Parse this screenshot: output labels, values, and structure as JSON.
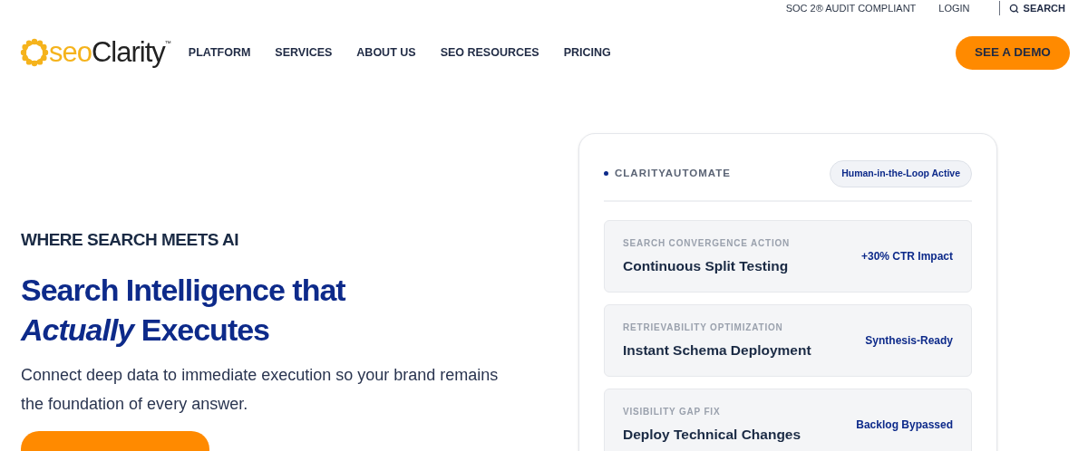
{
  "top_bar": {
    "links": [
      "SOC 2® AUDIT COMPLIANT",
      "LOGIN"
    ],
    "search": "SEARCH"
  },
  "header": {
    "logo": {
      "prefix": "seo",
      "name": "Clarity",
      "mark": "™"
    },
    "nav": [
      "PLATFORM",
      "SERVICES",
      "ABOUT US",
      "SEO RESOURCES",
      "PRICING"
    ],
    "cta": "SEE A DEMO"
  },
  "hero": {
    "eyebrow": "WHERE SEARCH MEETS AI",
    "title": "Search Intelligence that *Actually* Executes",
    "subtitle": "Connect deep data to immediate execution so your brand remains the foundation of every answer."
  },
  "panel": {
    "title": "CLARITYAUTOMATE",
    "status": "Human-in-the-Loop Active",
    "items": [
      {
        "category": "SEARCH CONVERGENCE ACTION",
        "title": "Continuous Split Testing",
        "result": "+30% CTR Impact"
      },
      {
        "category": "RETRIEVABILITY OPTIMIZATION",
        "title": "Instant Schema Deployment",
        "result": "Synthesis-Ready"
      },
      {
        "category": "VISIBILITY GAP FIX",
        "title": "Deploy Technical Changes",
        "result": "Backlog Bypassed"
      }
    ]
  }
}
